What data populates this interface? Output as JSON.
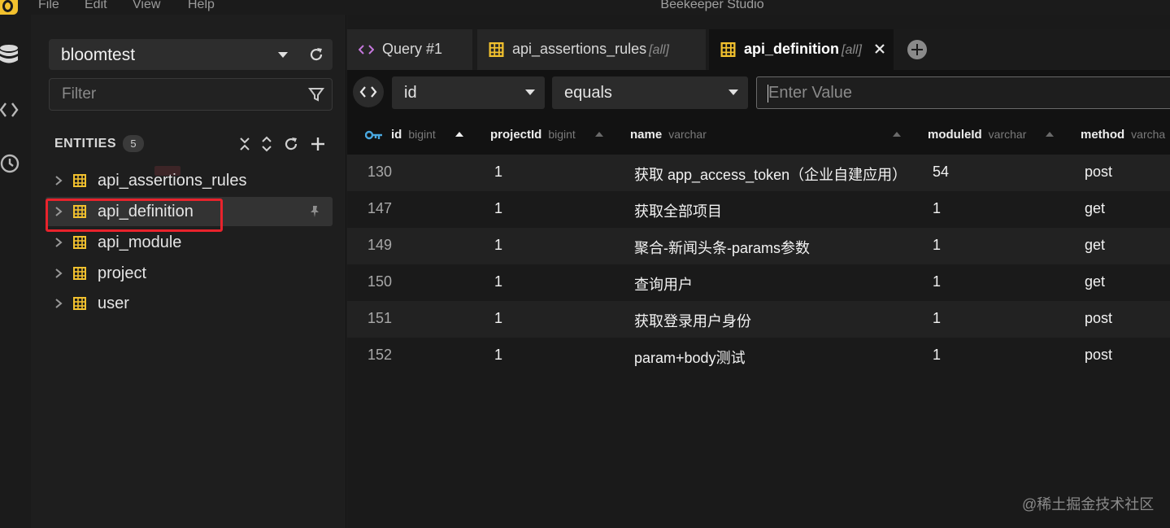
{
  "window": {
    "title": "Beekeeper Studio",
    "menu": [
      "File",
      "Edit",
      "View",
      "Help"
    ]
  },
  "activity_bar": {
    "icons": [
      "database-icon",
      "code-icon",
      "history-icon"
    ]
  },
  "sidebar": {
    "connection": {
      "label": "bloomtest"
    },
    "filter": {
      "placeholder": "Filter"
    },
    "entities": {
      "header": "ENTITIES",
      "count": "5",
      "items": [
        {
          "label": "api_assertions_rules",
          "selected": false
        },
        {
          "label": "api_definition",
          "selected": true
        },
        {
          "label": "api_module",
          "selected": false
        },
        {
          "label": "project",
          "selected": false
        },
        {
          "label": "user",
          "selected": false
        }
      ]
    }
  },
  "tabs": [
    {
      "label": "Query #1",
      "scope": "",
      "icon": "code-icon",
      "active": false
    },
    {
      "label": "api_assertions_rules",
      "scope": "[all]",
      "icon": "table-icon",
      "active": false
    },
    {
      "label": "api_definition",
      "scope": "[all]",
      "icon": "table-icon",
      "active": true
    }
  ],
  "filterbar": {
    "column": "id",
    "operator": "equals",
    "value_placeholder": "Enter Value"
  },
  "grid": {
    "columns": [
      {
        "name": "id",
        "type": "bigint",
        "sort": "asc",
        "key": true
      },
      {
        "name": "projectId",
        "type": "bigint",
        "sort": "none"
      },
      {
        "name": "name",
        "type": "varchar",
        "sort": "none"
      },
      {
        "name": "moduleId",
        "type": "varchar",
        "sort": "none"
      },
      {
        "name": "method",
        "type": "varcha"
      }
    ],
    "rows": [
      [
        "130",
        "1",
        "获取 app_access_token（企业自建应用）",
        "54",
        "post"
      ],
      [
        "147",
        "1",
        "获取全部项目",
        "1",
        "get"
      ],
      [
        "149",
        "1",
        "聚合-新闻头条-params参数",
        "1",
        "get"
      ],
      [
        "150",
        "1",
        "查询用户",
        "1",
        "get"
      ],
      [
        "151",
        "1",
        "获取登录用户身份",
        "1",
        "post"
      ],
      [
        "152",
        "1",
        "param+body测试",
        "1",
        "post"
      ]
    ]
  },
  "watermark": "@稀土掘金技术社区",
  "colors": {
    "accent": "#f2c12e",
    "highlight": "#e8232c",
    "query_icon": "#c678dd"
  }
}
